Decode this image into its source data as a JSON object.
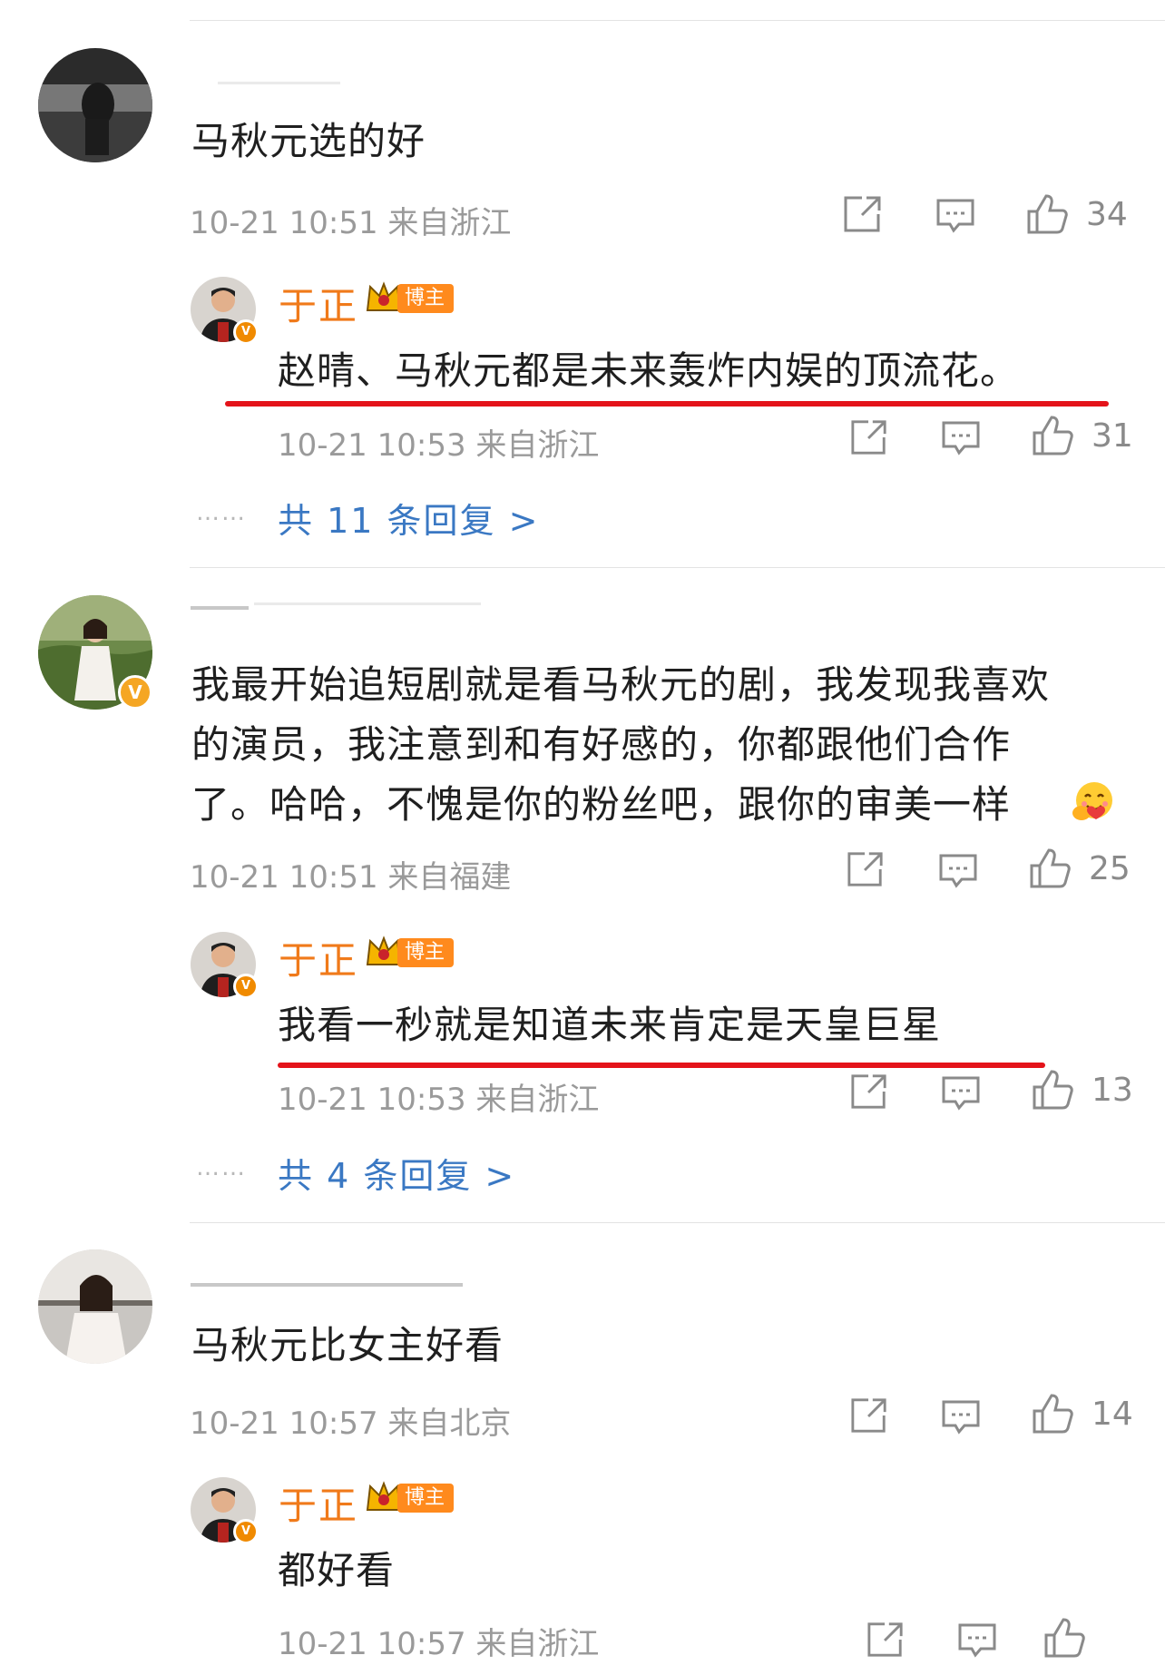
{
  "comments": [
    {
      "text": "马秋元选的好",
      "time": "10-21 10:51",
      "location": "来自浙江",
      "likes": "34",
      "reply": {
        "author": "于正",
        "badge": "博主",
        "text": "赵晴、马秋元都是未来轰炸内娱的顶流花。",
        "time": "10-21 10:53",
        "location": "来自浙江",
        "likes": "31"
      },
      "more_replies": "共 11 条回复 >"
    },
    {
      "text_lines": [
        "我最开始追短剧就是看马秋元的剧，我发现我喜欢",
        "的演员，我注意到和有好感的，你都跟他们合作",
        "了。哈哈，不愧是你的粉丝吧，跟你的审美一样"
      ],
      "time": "10-21 10:51",
      "location": "来自福建",
      "likes": "25",
      "reply": {
        "author": "于正",
        "badge": "博主",
        "text": "我看一秒就是知道未来肯定是天皇巨星",
        "time": "10-21 10:53",
        "location": "来自浙江",
        "likes": "13"
      },
      "more_replies": "共 4 条回复 >"
    },
    {
      "text": "马秋元比女主好看",
      "time": "10-21 10:57",
      "location": "来自北京",
      "likes": "14",
      "reply": {
        "author": "于正",
        "badge": "博主",
        "text": "都好看",
        "time": "10-21 10:57",
        "location": "来自浙江",
        "likes": ""
      }
    }
  ],
  "dots": "……",
  "verified_mark": "V",
  "colors": {
    "accent_orange": "#f07a1a",
    "link_blue": "#3a78c3",
    "underline_red": "#e4131a",
    "meta_gray": "#9a9a9a"
  },
  "icons": [
    "share-icon",
    "comment-icon",
    "like-icon",
    "crown-icon",
    "hug-emoji"
  ]
}
